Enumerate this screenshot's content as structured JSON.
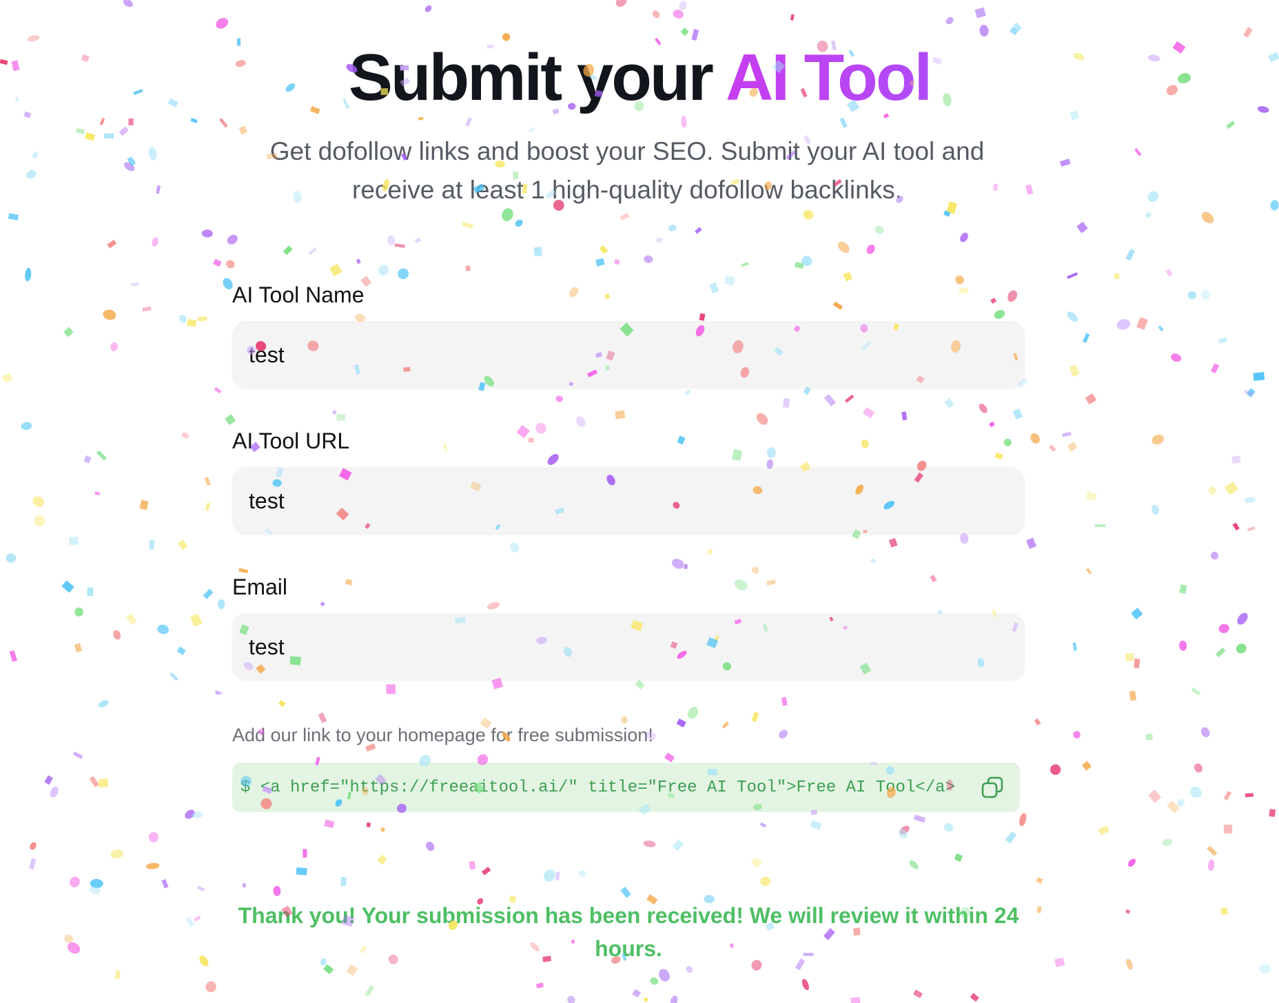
{
  "header": {
    "title_prefix": "Submit your ",
    "title_accent": "AI Tool",
    "subtitle": "Get dofollow links and boost your SEO. Submit your AI tool and receive at least 1 high-quality dofollow backlinks."
  },
  "form": {
    "name_label": "AI Tool Name",
    "name_value": "test",
    "url_label": "AI Tool URL",
    "url_value": "test",
    "email_label": "Email",
    "email_value": "test"
  },
  "backlink": {
    "hint": "Add our link to your homepage for free submission!",
    "code": "$ <a href=\"https://freeaitool.ai/\" title=\"Free AI Tool\">Free AI Tool</a>",
    "copy_icon": "copy-icon"
  },
  "status": {
    "message": "Thank you! Your submission has been received! We will review it within 24 hours."
  },
  "colors": {
    "accent": "#c73df0",
    "success": "#4ebf64",
    "code_bg": "#e3f4e3",
    "confetti": [
      "#f35ee6",
      "#a45cf6",
      "#4fc3f7",
      "#f7e55c",
      "#f47c7c",
      "#7be084",
      "#f5a849",
      "#e63b6f",
      "#c8a2f7",
      "#a6e3f7"
    ]
  }
}
